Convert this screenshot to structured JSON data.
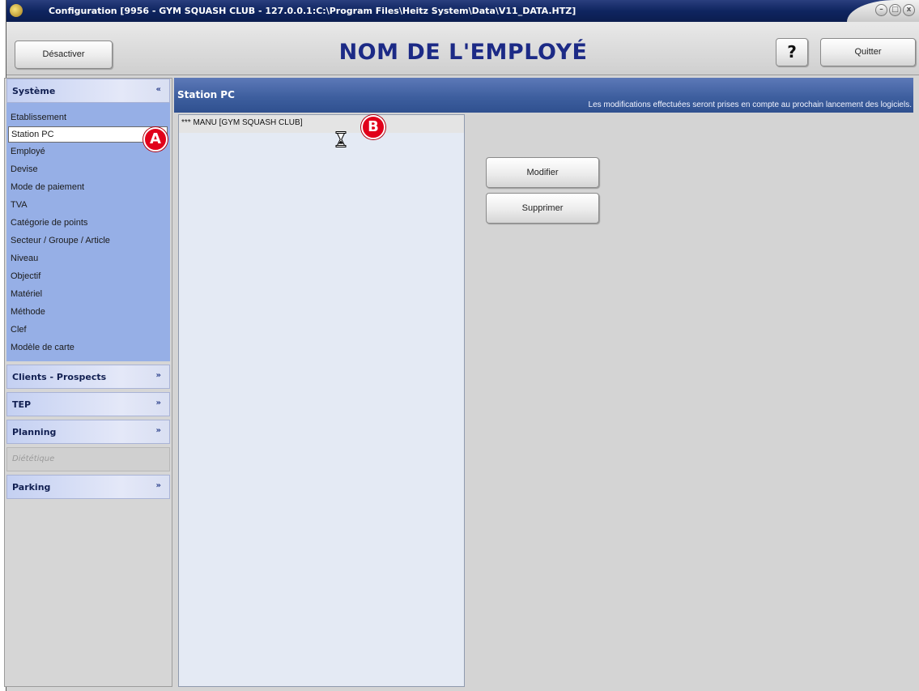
{
  "window": {
    "title": "Configuration [9956 - GYM SQUASH CLUB - 127.0.0.1:C:\\Program Files\\Heitz System\\Data\\V11_DATA.HTZ]",
    "minimize_glyph": "–",
    "maximize_glyph": "□",
    "close_glyph": "x"
  },
  "header": {
    "deactivate_label": "Désactiver",
    "page_title": "NOM DE L'EMPLOYÉ",
    "help_label": "?",
    "quit_label": "Quitter"
  },
  "sidebar": {
    "groups": [
      {
        "label": "Système",
        "expanded": true,
        "chevron": "«",
        "items": [
          {
            "label": "Etablissement"
          },
          {
            "label": "Station PC",
            "selected": true
          },
          {
            "label": "Employé"
          },
          {
            "label": "Devise"
          },
          {
            "label": "Mode de paiement"
          },
          {
            "label": "TVA"
          },
          {
            "label": "Catégorie de points"
          },
          {
            "label": "Secteur / Groupe / Article"
          },
          {
            "label": "Niveau"
          },
          {
            "label": "Objectif"
          },
          {
            "label": "Matériel"
          },
          {
            "label": "Méthode"
          },
          {
            "label": "Clef"
          },
          {
            "label": "Modèle de carte"
          }
        ]
      },
      {
        "label": "Clients - Prospects",
        "expanded": false,
        "chevron": "»"
      },
      {
        "label": "TEP",
        "expanded": false,
        "chevron": "»"
      },
      {
        "label": "Planning",
        "expanded": false,
        "chevron": "»"
      },
      {
        "label": "Diététique",
        "disabled": true
      },
      {
        "label": "Parking",
        "expanded": false,
        "chevron": "»"
      }
    ]
  },
  "content": {
    "section_title": "Station PC",
    "notice": "Les modifications effectuées seront prises en compte au prochain lancement des logiciels.",
    "list": [
      {
        "label": "*** MANU [GYM SQUASH CLUB]"
      }
    ],
    "actions": {
      "modify_label": "Modifier",
      "delete_label": "Supprimer"
    }
  },
  "annotations": {
    "marker_a": "A",
    "marker_b": "B"
  },
  "icons": [
    "app-icon",
    "minimize-icon",
    "maximize-icon",
    "close-icon",
    "collapse-chevron-icon",
    "expand-chevron-icon",
    "hourglass-cursor-icon"
  ],
  "colors": {
    "title_blue": "#1c2a86",
    "sidebar_items_bg": "#96afe6",
    "content_header_bg": "#3e5f9f",
    "marker_red": "#e1001a"
  }
}
